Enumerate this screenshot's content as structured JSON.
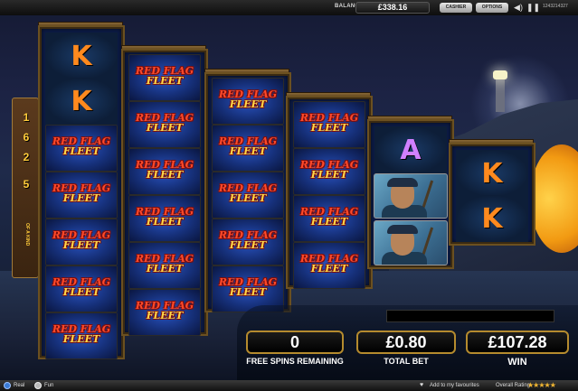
{
  "topbar": {
    "balance_label": "BALANCE",
    "balance_value": "£338.16",
    "cashier_label": "CASHIER",
    "options_label": "OPTIONS",
    "session_id": "1243214327"
  },
  "paylines": {
    "numbers": [
      "1",
      "6",
      "2",
      "5"
    ],
    "suffix": "OF A KIND"
  },
  "reels": [
    {
      "symbols": [
        "K",
        "K",
        "RED FLAG FLEET",
        "RED FLAG FLEET",
        "RED FLAG FLEET",
        "RED FLAG FLEET",
        "RED FLAG FLEET"
      ]
    },
    {
      "symbols": [
        "RED FLAG FLEET",
        "RED FLAG FLEET",
        "RED FLAG FLEET",
        "RED FLAG FLEET",
        "RED FLAG FLEET",
        "RED FLAG FLEET"
      ]
    },
    {
      "symbols": [
        "RED FLAG FLEET",
        "RED FLAG FLEET",
        "RED FLAG FLEET",
        "RED FLAG FLEET",
        "RED FLAG FLEET"
      ]
    },
    {
      "symbols": [
        "RED FLAG FLEET",
        "RED FLAG FLEET",
        "RED FLAG FLEET",
        "RED FLAG FLEET"
      ]
    },
    {
      "symbols": [
        "A",
        "pirate",
        "pirate"
      ]
    },
    {
      "symbols": [
        "K",
        "K"
      ]
    }
  ],
  "logo": {
    "line1": "RED FLAG",
    "line2": "FLEET"
  },
  "counters": {
    "free_spins_value": "0",
    "free_spins_label": "FREE SPINS REMAINING",
    "total_bet_value": "£0.80",
    "total_bet_label": "TOTAL BET",
    "win_value": "£107.28",
    "win_label": "WIN"
  },
  "bottombar": {
    "real_label": "Real",
    "fun_label": "Fun",
    "favourites_label": "Add to my favourites",
    "rating_label": "Overall Rating",
    "rating_stars": "★★★★★"
  },
  "colors": {
    "accent_gold": "#b58b2e",
    "letter_k": "#ff8a1e",
    "letter_a": "#d080ff"
  }
}
